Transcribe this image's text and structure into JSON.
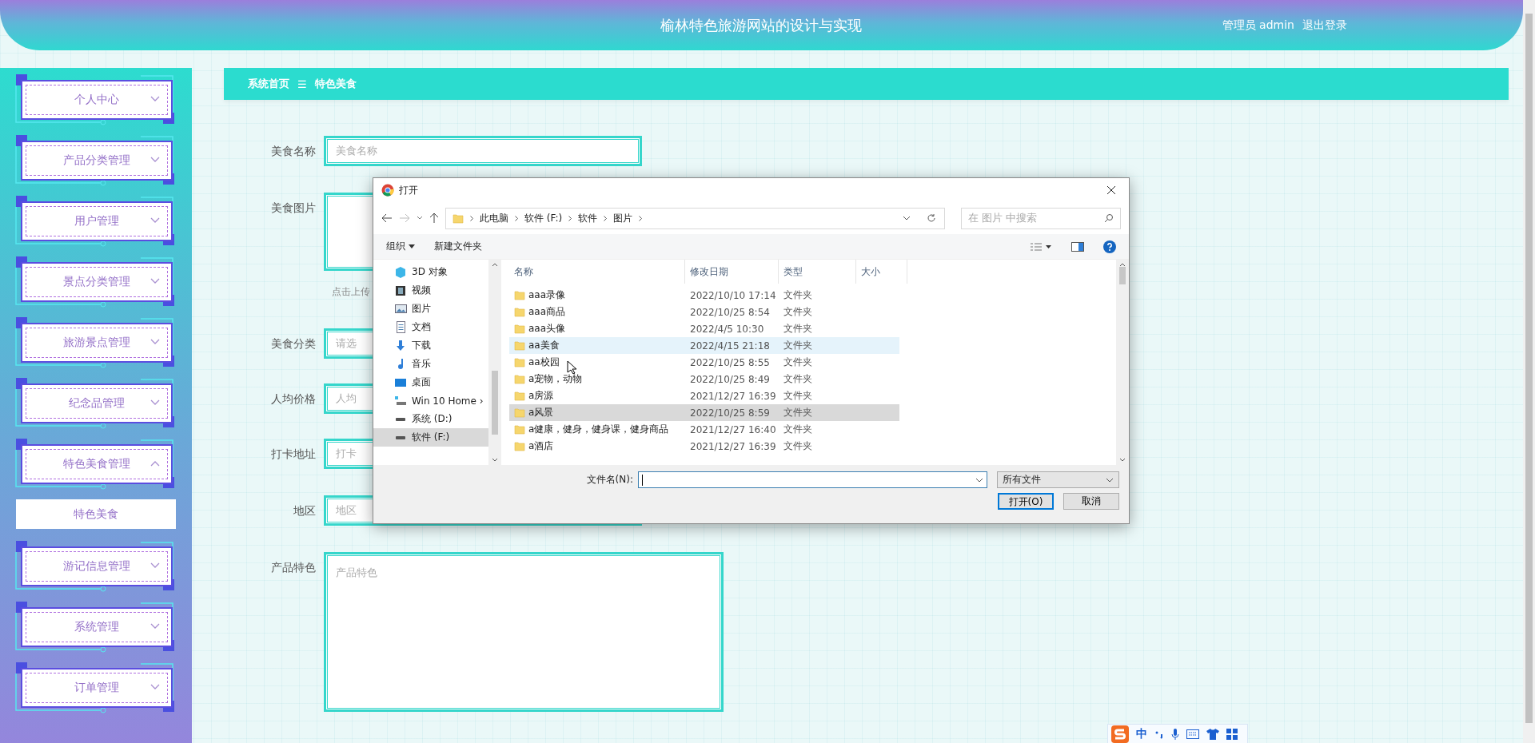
{
  "header": {
    "title": "榆林特色旅游网站的设计与实现",
    "user": "管理员 admin",
    "logout": "退出登录"
  },
  "sidebar": {
    "items": [
      {
        "label": "个人中心",
        "expanded": false
      },
      {
        "label": "产品分类管理",
        "expanded": false
      },
      {
        "label": "用户管理",
        "expanded": false
      },
      {
        "label": "景点分类管理",
        "expanded": false
      },
      {
        "label": "旅游景点管理",
        "expanded": false
      },
      {
        "label": "纪念品管理",
        "expanded": false
      },
      {
        "label": "特色美食管理",
        "expanded": true,
        "children": [
          {
            "label": "特色美食",
            "selected": true
          }
        ]
      },
      {
        "label": "游记信息管理",
        "expanded": false
      },
      {
        "label": "系统管理",
        "expanded": false
      },
      {
        "label": "订单管理",
        "expanded": false
      }
    ]
  },
  "breadcrumb": {
    "home": "系统首页",
    "separator": "☰",
    "current": "特色美食"
  },
  "form": {
    "fields": [
      {
        "kind": "input",
        "label": "美食名称",
        "placeholder": "美食名称"
      },
      {
        "kind": "upload",
        "label": "美食图片",
        "hint": "点击上传"
      },
      {
        "kind": "input",
        "label": "美食分类",
        "placeholder": "请选"
      },
      {
        "kind": "input",
        "label": "人均价格",
        "placeholder": "人均"
      },
      {
        "kind": "input",
        "label": "打卡地址",
        "placeholder": "打卡"
      },
      {
        "kind": "input",
        "label": "地区",
        "placeholder": "地区"
      },
      {
        "kind": "textarea",
        "label": "产品特色",
        "placeholder": "产品特色"
      }
    ]
  },
  "dialog": {
    "title": "打开",
    "path": [
      "此电脑",
      "软件 (F:)",
      "软件",
      "图片"
    ],
    "search": {
      "placeholder": "在 图片 中搜索"
    },
    "toolbar": {
      "organize": "组织",
      "new_folder": "新建文件夹"
    },
    "nav": [
      {
        "label": "3D 对象",
        "selected": false
      },
      {
        "label": "视频",
        "selected": false
      },
      {
        "label": "图片",
        "selected": false
      },
      {
        "label": "文档",
        "selected": false
      },
      {
        "label": "下载",
        "selected": false
      },
      {
        "label": "音乐",
        "selected": false
      },
      {
        "label": "桌面",
        "selected": false
      },
      {
        "label": "Win 10 Home ›",
        "selected": false
      },
      {
        "label": "系统 (D:)",
        "selected": false
      },
      {
        "label": "软件 (F:)",
        "selected": true
      }
    ],
    "columns": [
      "名称",
      "修改日期",
      "类型",
      "大小"
    ],
    "rows": [
      {
        "name": "aaa录像",
        "date": "2022/10/10 17:14",
        "type": "文件夹",
        "hovered": false,
        "selected": false
      },
      {
        "name": "aaa商品",
        "date": "2022/10/25 8:54",
        "type": "文件夹",
        "hovered": false,
        "selected": false
      },
      {
        "name": "aaa头像",
        "date": "2022/4/5 10:30",
        "type": "文件夹",
        "hovered": false,
        "selected": false
      },
      {
        "name": "aa美食",
        "date": "2022/4/15 21:18",
        "type": "文件夹",
        "hovered": true,
        "selected": false
      },
      {
        "name": "aa校园",
        "date": "2022/10/25 8:55",
        "type": "文件夹",
        "hovered": false,
        "selected": false
      },
      {
        "name": "a宠物，动物",
        "date": "2022/10/25 8:49",
        "type": "文件夹",
        "hovered": false,
        "selected": false
      },
      {
        "name": "a房源",
        "date": "2021/12/27 16:39",
        "type": "文件夹",
        "hovered": false,
        "selected": false
      },
      {
        "name": "a风景",
        "date": "2022/10/25 8:59",
        "type": "文件夹",
        "hovered": false,
        "selected": true
      },
      {
        "name": "a健康，健身，健身课，健身商品",
        "date": "2021/12/27 16:40",
        "type": "文件夹",
        "hovered": false,
        "selected": false
      },
      {
        "name": "a酒店",
        "date": "2021/12/27 16:39",
        "type": "文件夹",
        "hovered": false,
        "selected": false
      }
    ],
    "filename_label": "文件名(N):",
    "filter": "所有文件",
    "buttons": [
      {
        "label": "打开(O)",
        "kind": "primary"
      },
      {
        "label": "取消",
        "kind": "normal"
      }
    ]
  },
  "ime": {
    "mode": "中"
  }
}
